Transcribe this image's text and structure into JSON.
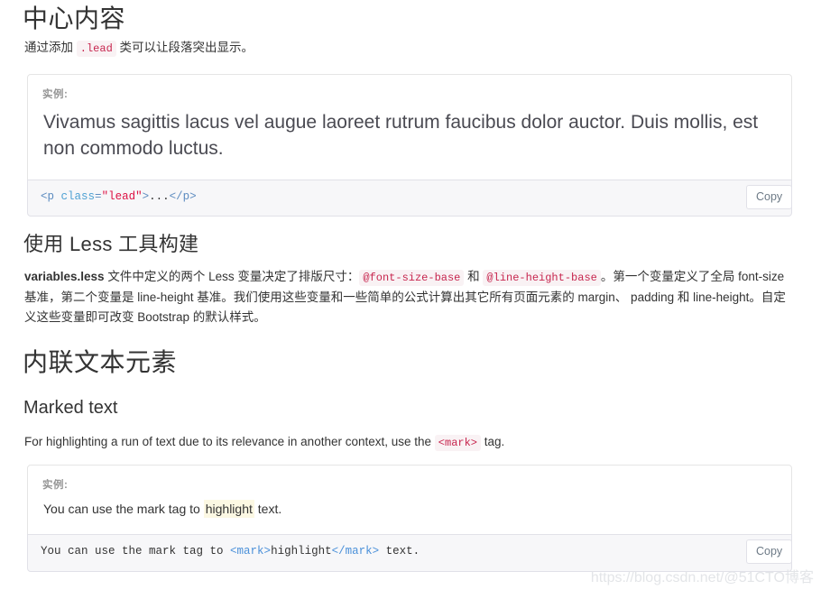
{
  "sections": {
    "center_content": {
      "heading": "中心内容",
      "intro_before": "通过添加",
      "intro_code": ".lead",
      "intro_after": "类可以让段落突出显示。",
      "example_label": "实例:",
      "lead_paragraph": "Vivamus sagittis lacus vel augue laoreet rutrum faucibus dolor auctor. Duis mollis, est non commodo luctus.",
      "code": {
        "tag_open": "<p",
        "attr": "class",
        "eq": "=",
        "value": "\"lead\"",
        "gt": ">",
        "ellipsis": "...",
        "tag_close": "</p>"
      },
      "copy_label": "Copy"
    },
    "less_build": {
      "heading": "使用 Less 工具构建",
      "bold_lead": "variables.less",
      "text_1": " 文件中定义的两个 Less 变量决定了排版尺寸：",
      "code_1": "@font-size-base",
      "text_2": "和",
      "code_2": "@line-height-base",
      "text_3": "。第一个变量定义了全局 font-size 基准，第二个变量是 line-height 基准。我们使用这些变量和一些简单的公式计算出其它所有页面元素的 margin、 padding 和 line-height。自定义这些变量即可改变 Bootstrap 的默认样式。"
    },
    "inline_elements": {
      "heading": "内联文本元素",
      "subheading": "Marked text",
      "intro_before": "For highlighting a run of text due to its relevance in another context, use the",
      "intro_code": "<mark>",
      "intro_after": "tag.",
      "example_label": "实例:",
      "example_text_before": "You can use the mark tag to ",
      "example_marked": "highlight",
      "example_text_after": " text.",
      "code": {
        "prefix": "You can use the mark tag to ",
        "mark_open": "<mark>",
        "mark_text": "highlight",
        "mark_close": "</mark>",
        "suffix": " text."
      },
      "copy_label": "Copy"
    }
  },
  "watermark": "https://blog.csdn.net/@51CTO博客",
  "colors": {
    "inline_code_text": "#c7254e",
    "inline_code_bg": "#f9f2f4",
    "code_block_bg": "#f7f7f9",
    "code_block_border": "#e1e1e8",
    "example_border": "#e5e5e5",
    "mark_bg": "#fcf8e3",
    "text": "#333333",
    "muted": "#959595"
  }
}
